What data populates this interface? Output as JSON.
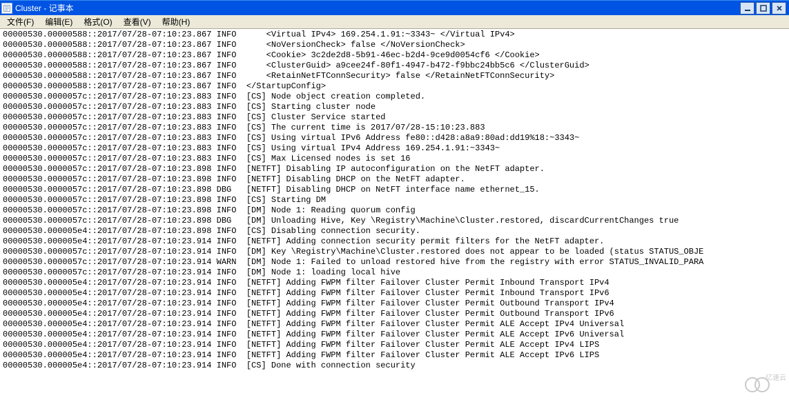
{
  "window": {
    "title": "Cluster - 记事本"
  },
  "menu": {
    "file": "文件(F)",
    "edit": "编辑(E)",
    "format": "格式(O)",
    "view": "查看(V)",
    "help": "帮助(H)"
  },
  "log_lines": [
    "00000530.00000588::2017/07/28-07:10:23.867 INFO      <Virtual IPv4> 169.254.1.91:~3343~ </Virtual IPv4>",
    "00000530.00000588::2017/07/28-07:10:23.867 INFO      <NoVersionCheck> false </NoVersionCheck>",
    "00000530.00000588::2017/07/28-07:10:23.867 INFO      <Cookie> 3c2de2d8-5b91-46ec-b2d4-9ce9d0054cf6 </Cookie>",
    "00000530.00000588::2017/07/28-07:10:23.867 INFO      <ClusterGuid> a9cee24f-80f1-4947-b472-f9bbc24bb5c6 </ClusterGuid>",
    "00000530.00000588::2017/07/28-07:10:23.867 INFO      <RetainNetFTConnSecurity> false </RetainNetFTConnSecurity>",
    "00000530.00000588::2017/07/28-07:10:23.867 INFO  </StartupConfig>",
    "00000530.0000057c::2017/07/28-07:10:23.883 INFO  [CS] Node object creation completed.",
    "00000530.0000057c::2017/07/28-07:10:23.883 INFO  [CS] Starting cluster node",
    "00000530.0000057c::2017/07/28-07:10:23.883 INFO  [CS] Cluster Service started",
    "00000530.0000057c::2017/07/28-07:10:23.883 INFO  [CS] The current time is 2017/07/28-15:10:23.883",
    "00000530.0000057c::2017/07/28-07:10:23.883 INFO  [CS] Using virtual IPv6 Address fe80::d428:a8a9:80ad:dd19%18:~3343~",
    "00000530.0000057c::2017/07/28-07:10:23.883 INFO  [CS] Using virtual IPv4 Address 169.254.1.91:~3343~",
    "00000530.0000057c::2017/07/28-07:10:23.883 INFO  [CS] Max Licensed nodes is set 16",
    "00000530.0000057c::2017/07/28-07:10:23.898 INFO  [NETFT] Disabling IP autoconfiguration on the NetFT adapter.",
    "00000530.0000057c::2017/07/28-07:10:23.898 INFO  [NETFT] Disabling DHCP on the NetFT adapter.",
    "00000530.0000057c::2017/07/28-07:10:23.898 DBG   [NETFT] Disabling DHCP on NetFT interface name ethernet_15.",
    "00000530.0000057c::2017/07/28-07:10:23.898 INFO  [CS] Starting DM",
    "00000530.0000057c::2017/07/28-07:10:23.898 INFO  [DM] Node 1: Reading quorum config",
    "00000530.0000057c::2017/07/28-07:10:23.898 DBG   [DM] Unloading Hive, Key \\Registry\\Machine\\Cluster.restored, discardCurrentChanges true",
    "00000530.000005e4::2017/07/28-07:10:23.898 INFO  [CS] Disabling connection security.",
    "00000530.000005e4::2017/07/28-07:10:23.914 INFO  [NETFT] Adding connection security permit filters for the NetFT adapter.",
    "00000530.0000057c::2017/07/28-07:10:23.914 INFO  [DM] Key \\Registry\\Machine\\Cluster.restored does not appear to be loaded (status STATUS_OBJE",
    "00000530.0000057c::2017/07/28-07:10:23.914 WARN  [DM] Node 1: Failed to unload restored hive from the registry with error STATUS_INVALID_PARA",
    "00000530.0000057c::2017/07/28-07:10:23.914 INFO  [DM] Node 1: loading local hive",
    "00000530.000005e4::2017/07/28-07:10:23.914 INFO  [NETFT] Adding FWPM filter Failover Cluster Permit Inbound Transport IPv4",
    "00000530.000005e4::2017/07/28-07:10:23.914 INFO  [NETFT] Adding FWPM filter Failover Cluster Permit Inbound Transport IPv6",
    "00000530.000005e4::2017/07/28-07:10:23.914 INFO  [NETFT] Adding FWPM filter Failover Cluster Permit Outbound Transport IPv4",
    "00000530.000005e4::2017/07/28-07:10:23.914 INFO  [NETFT] Adding FWPM filter Failover Cluster Permit Outbound Transport IPv6",
    "00000530.000005e4::2017/07/28-07:10:23.914 INFO  [NETFT] Adding FWPM filter Failover Cluster Permit ALE Accept IPv4 Universal",
    "00000530.000005e4::2017/07/28-07:10:23.914 INFO  [NETFT] Adding FWPM filter Failover Cluster Permit ALE Accept IPv6 Universal",
    "00000530.000005e4::2017/07/28-07:10:23.914 INFO  [NETFT] Adding FWPM filter Failover Cluster Permit ALE Accept IPv4 LIPS",
    "00000530.000005e4::2017/07/28-07:10:23.914 INFO  [NETFT] Adding FWPM filter Failover Cluster Permit ALE Accept IPv6 LIPS",
    "00000530.000005e4::2017/07/28-07:10:23.914 INFO  [CS] Done with connection security"
  ],
  "watermark": {
    "text": "亿速云"
  }
}
